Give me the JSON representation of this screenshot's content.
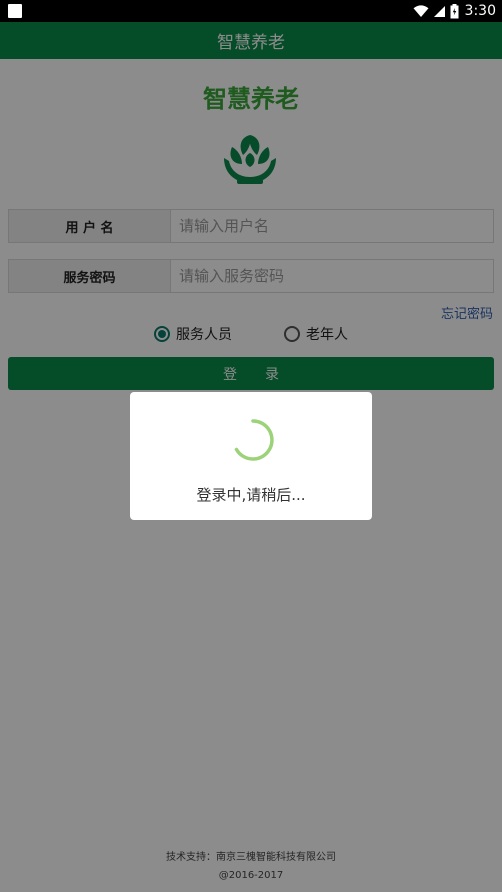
{
  "status_bar": {
    "time": "3:30"
  },
  "app_bar": {
    "title": "智慧养老"
  },
  "content": {
    "app_title": "智慧养老",
    "username": {
      "label": "用 户 名",
      "placeholder": "请输入用户名",
      "value": ""
    },
    "password": {
      "label": "服务密码",
      "placeholder": "请输入服务密码",
      "value": ""
    },
    "forgot_password": "忘记密码",
    "roles": [
      {
        "label": "服务人员",
        "checked": true
      },
      {
        "label": "老年人",
        "checked": false
      }
    ],
    "login_button": "登录",
    "footer": {
      "support": "技术支持：南京三槐智能科技有限公司",
      "copyright": "@2016-2017"
    }
  },
  "dialog": {
    "message": "登录中,请稍后..."
  },
  "colors": {
    "primary": "#0a8a4a",
    "title_green": "#3aa63a",
    "link_blue": "#2f5fb0",
    "radio_checked": "#0a7a6a",
    "spinner": "#9bd27a"
  },
  "icons": [
    "wifi-icon",
    "signal-icon",
    "battery-icon",
    "leaf-hands-logo-icon",
    "loading-spinner-icon"
  ]
}
